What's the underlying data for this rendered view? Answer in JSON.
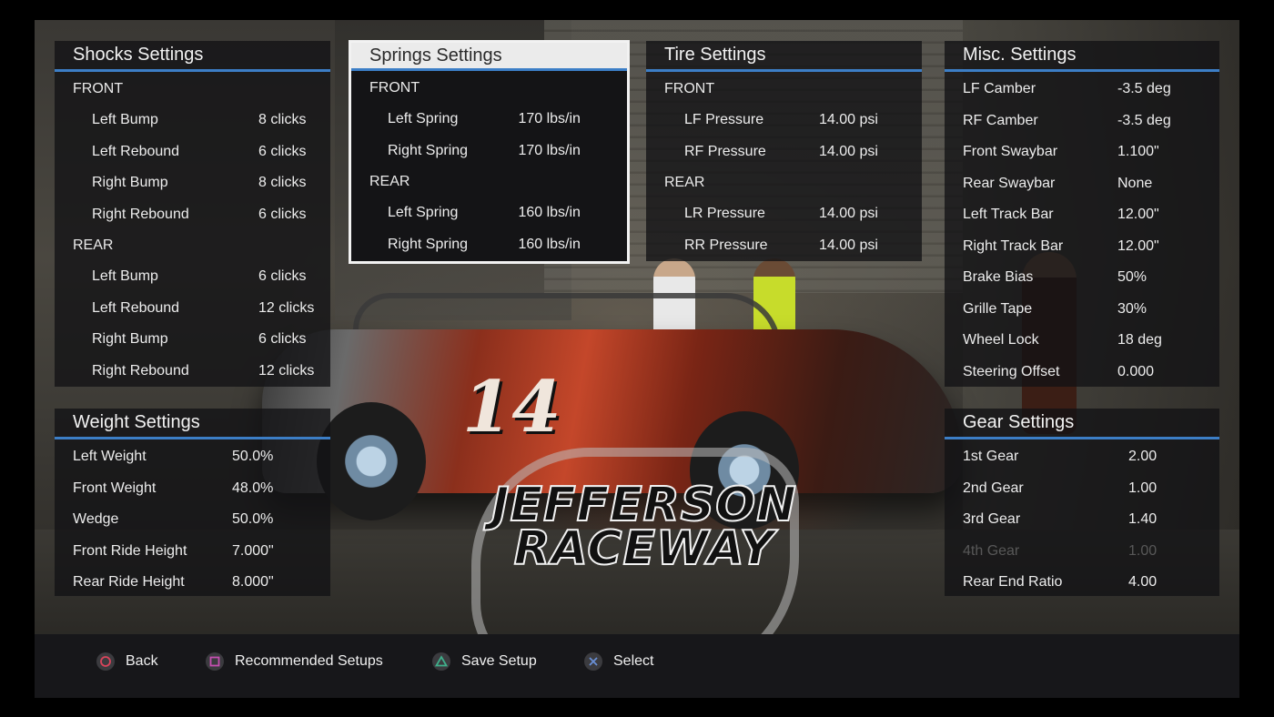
{
  "accent_color": "#3c7ec6",
  "panels": {
    "shocks": {
      "title": "Shocks Settings",
      "front_label": "FRONT",
      "front": [
        {
          "label": "Left Bump",
          "value": "8 clicks"
        },
        {
          "label": "Left Rebound",
          "value": "6 clicks"
        },
        {
          "label": "Right Bump",
          "value": "8 clicks"
        },
        {
          "label": "Right Rebound",
          "value": "6 clicks"
        }
      ],
      "rear_label": "REAR",
      "rear": [
        {
          "label": "Left Bump",
          "value": "6 clicks"
        },
        {
          "label": "Left Rebound",
          "value": "12 clicks"
        },
        {
          "label": "Right Bump",
          "value": "6 clicks"
        },
        {
          "label": "Right Rebound",
          "value": "12 clicks"
        }
      ]
    },
    "springs": {
      "title": "Springs Settings",
      "front_label": "FRONT",
      "front": [
        {
          "label": "Left Spring",
          "value": "170 lbs/in"
        },
        {
          "label": "Right Spring",
          "value": "170 lbs/in"
        }
      ],
      "rear_label": "REAR",
      "rear": [
        {
          "label": "Left Spring",
          "value": "160 lbs/in"
        },
        {
          "label": "Right Spring",
          "value": "160 lbs/in"
        }
      ]
    },
    "tires": {
      "title": "Tire Settings",
      "front_label": "FRONT",
      "front": [
        {
          "label": "LF Pressure",
          "value": "14.00 psi"
        },
        {
          "label": "RF Pressure",
          "value": "14.00 psi"
        }
      ],
      "rear_label": "REAR",
      "rear": [
        {
          "label": "LR Pressure",
          "value": "14.00 psi"
        },
        {
          "label": "RR Pressure",
          "value": "14.00 psi"
        }
      ]
    },
    "misc": {
      "title": "Misc. Settings",
      "rows": [
        {
          "label": "LF Camber",
          "value": "-3.5 deg"
        },
        {
          "label": "RF Camber",
          "value": "-3.5 deg"
        },
        {
          "label": "Front Swaybar",
          "value": "1.100\""
        },
        {
          "label": "Rear Swaybar",
          "value": "None"
        },
        {
          "label": "Left Track Bar",
          "value": "12.00\""
        },
        {
          "label": "Right Track Bar",
          "value": "12.00\""
        },
        {
          "label": "Brake Bias",
          "value": "50%"
        },
        {
          "label": "Grille Tape",
          "value": "30%"
        },
        {
          "label": "Wheel Lock",
          "value": "18 deg"
        },
        {
          "label": "Steering Offset",
          "value": "0.000"
        }
      ]
    },
    "weight": {
      "title": "Weight Settings",
      "rows": [
        {
          "label": "Left Weight",
          "value": "50.0%"
        },
        {
          "label": "Front Weight",
          "value": "48.0%"
        },
        {
          "label": "Wedge",
          "value": "50.0%"
        },
        {
          "label": "Front Ride Height",
          "value": "7.000\""
        },
        {
          "label": "Rear Ride Height",
          "value": "8.000\""
        }
      ]
    },
    "gears": {
      "title": "Gear Settings",
      "rows": [
        {
          "label": "1st Gear",
          "value": "2.00"
        },
        {
          "label": "2nd Gear",
          "value": "1.00"
        },
        {
          "label": "3rd Gear",
          "value": "1.40"
        },
        {
          "label": "4th Gear",
          "value": "1.00"
        },
        {
          "label": "Rear End Ratio",
          "value": "4.00"
        }
      ]
    }
  },
  "track_logo": {
    "line1": "JEFFERSON",
    "line2": "RACEWAY"
  },
  "car_number": "14",
  "bottom_bar": {
    "back": {
      "glyph": "circle-button-icon",
      "color": "#d9445b",
      "label": "Back"
    },
    "recommended": {
      "glyph": "square-button-icon",
      "color": "#c44fb0",
      "label": "Recommended Setups"
    },
    "save": {
      "glyph": "triangle-button-icon",
      "color": "#3fae8a",
      "label": "Save Setup"
    },
    "select": {
      "glyph": "cross-button-icon",
      "color": "#6a8fd6",
      "label": "Select"
    }
  }
}
